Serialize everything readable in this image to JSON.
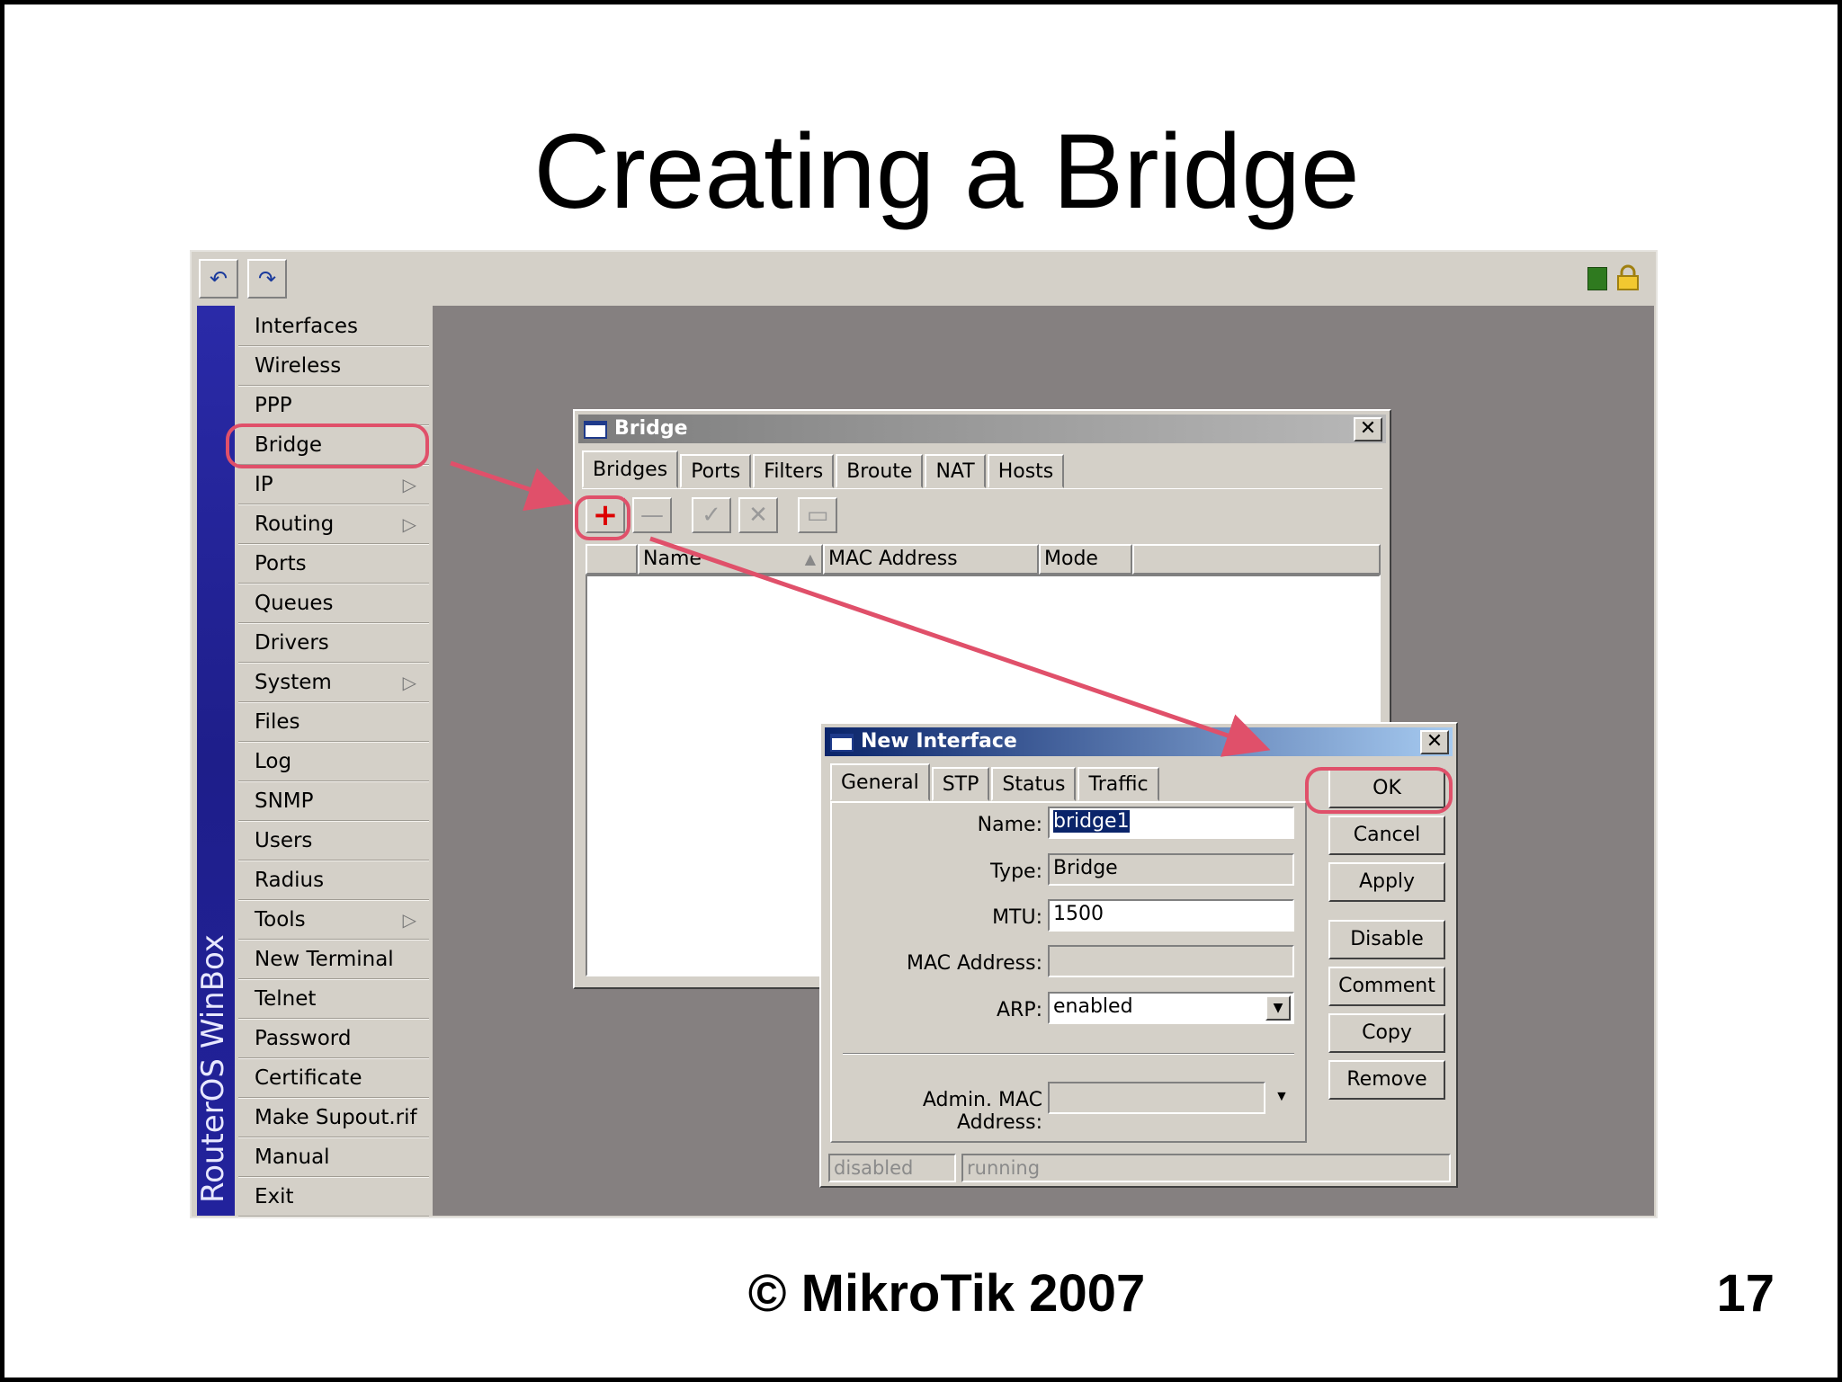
{
  "slide": {
    "title": "Creating a Bridge",
    "footer": "© MikroTik 2007",
    "page_number": "17"
  },
  "winbox": {
    "brand": "RouterOS WinBox",
    "toolbar_icons": [
      "undo-icon",
      "redo-icon"
    ],
    "menu": [
      {
        "label": "Interfaces",
        "submenu": false
      },
      {
        "label": "Wireless",
        "submenu": false
      },
      {
        "label": "PPP",
        "submenu": false
      },
      {
        "label": "Bridge",
        "submenu": false
      },
      {
        "label": "IP",
        "submenu": true
      },
      {
        "label": "Routing",
        "submenu": true
      },
      {
        "label": "Ports",
        "submenu": false
      },
      {
        "label": "Queues",
        "submenu": false
      },
      {
        "label": "Drivers",
        "submenu": false
      },
      {
        "label": "System",
        "submenu": true
      },
      {
        "label": "Files",
        "submenu": false
      },
      {
        "label": "Log",
        "submenu": false
      },
      {
        "label": "SNMP",
        "submenu": false
      },
      {
        "label": "Users",
        "submenu": false
      },
      {
        "label": "Radius",
        "submenu": false
      },
      {
        "label": "Tools",
        "submenu": true
      },
      {
        "label": "New Terminal",
        "submenu": false
      },
      {
        "label": "Telnet",
        "submenu": false
      },
      {
        "label": "Password",
        "submenu": false
      },
      {
        "label": "Certificate",
        "submenu": false
      },
      {
        "label": "Make Supout.rif",
        "submenu": false
      },
      {
        "label": "Manual",
        "submenu": false
      },
      {
        "label": "Exit",
        "submenu": false
      }
    ]
  },
  "bridge_window": {
    "title": "Bridge",
    "close": "✕",
    "tabs": [
      "Bridges",
      "Ports",
      "Filters",
      "Broute",
      "NAT",
      "Hosts"
    ],
    "active_tab": "Bridges",
    "toolbar": {
      "add": "+",
      "remove": "—",
      "enable": "✓",
      "disable": "✕",
      "comment": "▭"
    },
    "columns": [
      "Name",
      "MAC Address",
      "Mode"
    ],
    "sort_indicator": "▲"
  },
  "new_interface": {
    "title": "New Interface",
    "close": "✕",
    "tabs": [
      "General",
      "STP",
      "Status",
      "Traffic"
    ],
    "active_tab": "General",
    "fields": {
      "name_label": "Name:",
      "name_value": "bridge1",
      "type_label": "Type:",
      "type_value": "Bridge",
      "mtu_label": "MTU:",
      "mtu_value": "1500",
      "mac_label": "MAC Address:",
      "mac_value": "",
      "arp_label": "ARP:",
      "arp_value": "enabled",
      "admin_mac_label": "Admin. MAC Address:",
      "admin_mac_value": ""
    },
    "buttons": [
      "OK",
      "Cancel",
      "Apply",
      "Disable",
      "Comment",
      "Copy",
      "Remove"
    ],
    "status": [
      "disabled",
      "running"
    ]
  },
  "colors": {
    "annotation": "#e0506a",
    "titlebar_active": "#0a246a",
    "desktop": "#858080"
  }
}
